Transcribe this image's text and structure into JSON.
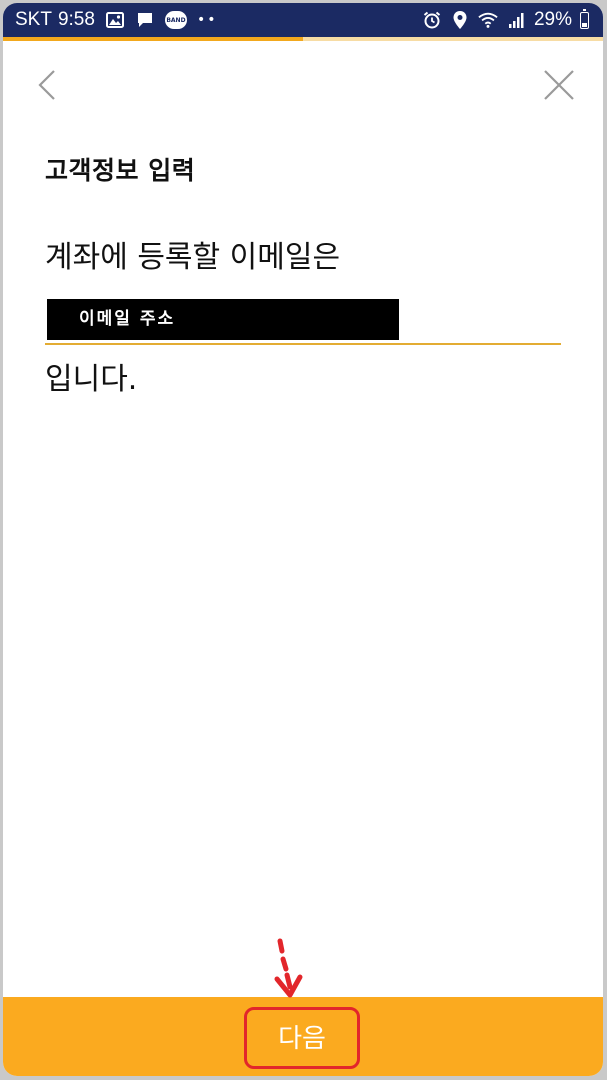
{
  "status_bar": {
    "carrier": "SKT",
    "time": "9:58",
    "notification_icons": [
      "image-icon",
      "message-icon",
      "band-icon",
      "more-dots-icon"
    ],
    "band_label": "BAND",
    "more_dots": "••",
    "system_icons": [
      "alarm-icon",
      "location-icon",
      "wifi-icon",
      "signal-icon"
    ],
    "battery": "29%",
    "background_color": "#1b2a63"
  },
  "progress": {
    "fraction": 0.5,
    "fill_color": "#f2a81d",
    "track_color": "#f7dca4"
  },
  "header": {
    "back_icon": "chevron-left-icon",
    "close_icon": "close-icon"
  },
  "content": {
    "title": "고객정보 입력",
    "prompt": "계좌에 등록할 이메일은",
    "email_value": "이메일 주소",
    "suffix": "입니다.",
    "accent_color": "#e3ac33"
  },
  "footer": {
    "next_label": "다음",
    "bar_color": "#fbaa1f",
    "highlight_color": "#e2262b"
  }
}
